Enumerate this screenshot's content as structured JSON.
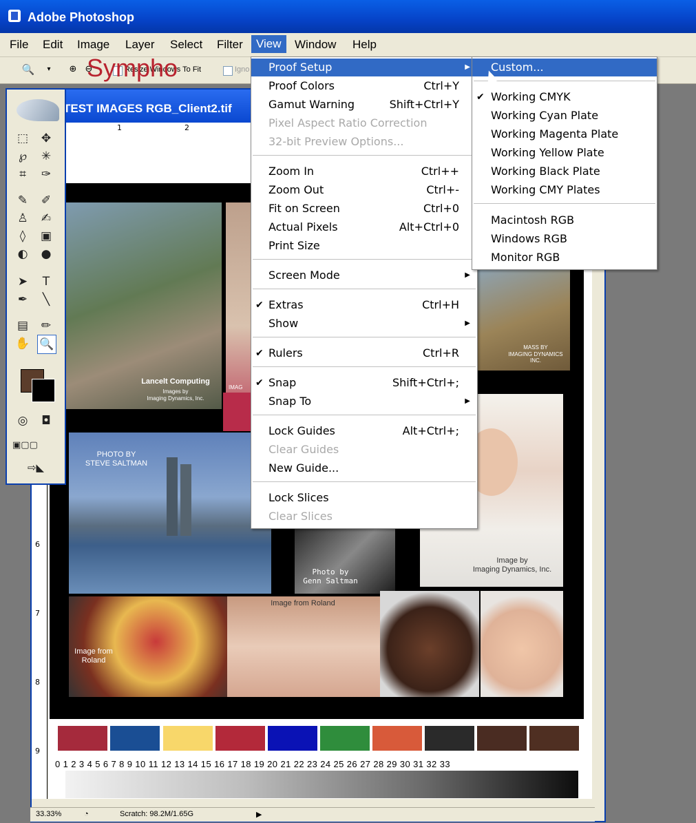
{
  "app": {
    "title": "Adobe Photoshop"
  },
  "menubar": [
    "File",
    "Edit",
    "Image",
    "Layer",
    "Select",
    "Filter",
    "View",
    "Window",
    "Help"
  ],
  "options_bar": {
    "resize_label": "Resize Windows To Fit",
    "ignore_label": "Igno"
  },
  "document": {
    "title": "TEST IMAGES RGB_Client2.tif",
    "brand_text": "Sympho",
    "ruler_h": [
      "1",
      "2"
    ],
    "ruler_v": [
      "6",
      "7",
      "8",
      "9"
    ]
  },
  "photos": {
    "p1_caption": "Lancelt Computing",
    "p1_sub": "Images by\nImaging Dynamics, Inc.",
    "p2_caption": "IMAG",
    "p3_caption": "MASS BY\nIMAGING DYNAMICS INC.",
    "city_caption": "PHOTO BY\nSTEVE SALTMAN",
    "guitar_caption": "Photo by\nGenn Saltman",
    "bride_caption": "Image by\nImaging Dynamics, Inc.",
    "fruit_caption": "Image from\nRoland",
    "face_caption": "Image from Roland"
  },
  "swatches": [
    "#a52a3c",
    "#1a4e94",
    "#f8d76a",
    "#b3293a",
    "#0a12b5",
    "#2f8d3c",
    "#d85a3a",
    "#2a2a2a",
    "#4a2c22",
    "#4f2f22"
  ],
  "scale_numbers": "0 1  2  3  4  5  6  7  8  9 10 11 12 13 14 15 16 17 18 19 20 21 22 23 24 25 26 27 28 29 30 31 32 33",
  "status": {
    "zoom": "33.33%",
    "scratch": "Scratch: 98.2M/1.65G"
  },
  "view_menu": [
    {
      "label": "Proof Setup",
      "shortcut": "",
      "submenu": true,
      "selected": true
    },
    {
      "label": "Proof Colors",
      "shortcut": "Ctrl+Y"
    },
    {
      "label": "Gamut Warning",
      "shortcut": "Shift+Ctrl+Y"
    },
    {
      "label": "Pixel Aspect Ratio Correction",
      "shortcut": "",
      "disabled": true
    },
    {
      "label": "32-bit Preview Options...",
      "shortcut": "",
      "disabled": true
    },
    {
      "label": "Zoom In",
      "shortcut": "Ctrl++"
    },
    {
      "label": "Zoom Out",
      "shortcut": "Ctrl+-"
    },
    {
      "label": "Fit on Screen",
      "shortcut": "Ctrl+0"
    },
    {
      "label": "Actual Pixels",
      "shortcut": "Alt+Ctrl+0"
    },
    {
      "label": "Print Size",
      "shortcut": ""
    },
    {
      "label": "Screen Mode",
      "shortcut": "",
      "submenu": true
    },
    {
      "label": "Extras",
      "shortcut": "Ctrl+H",
      "checked": true
    },
    {
      "label": "Show",
      "shortcut": "",
      "submenu": true
    },
    {
      "label": "Rulers",
      "shortcut": "Ctrl+R",
      "checked": true
    },
    {
      "label": "Snap",
      "shortcut": "Shift+Ctrl+;",
      "checked": true
    },
    {
      "label": "Snap To",
      "shortcut": "",
      "submenu": true
    },
    {
      "label": "Lock Guides",
      "shortcut": "Alt+Ctrl+;"
    },
    {
      "label": "Clear Guides",
      "shortcut": "",
      "disabled": true
    },
    {
      "label": "New Guide...",
      "shortcut": ""
    },
    {
      "label": "Lock Slices",
      "shortcut": ""
    },
    {
      "label": "Clear Slices",
      "shortcut": "",
      "disabled": true
    }
  ],
  "proof_submenu": [
    {
      "label": "Custom...",
      "selected": true
    },
    {
      "label": "Working CMYK",
      "checked": true
    },
    {
      "label": "Working Cyan Plate"
    },
    {
      "label": "Working Magenta Plate"
    },
    {
      "label": "Working Yellow Plate"
    },
    {
      "label": "Working Black Plate"
    },
    {
      "label": "Working CMY Plates"
    },
    {
      "label": "Macintosh RGB"
    },
    {
      "label": "Windows RGB"
    },
    {
      "label": "Monitor RGB"
    }
  ]
}
